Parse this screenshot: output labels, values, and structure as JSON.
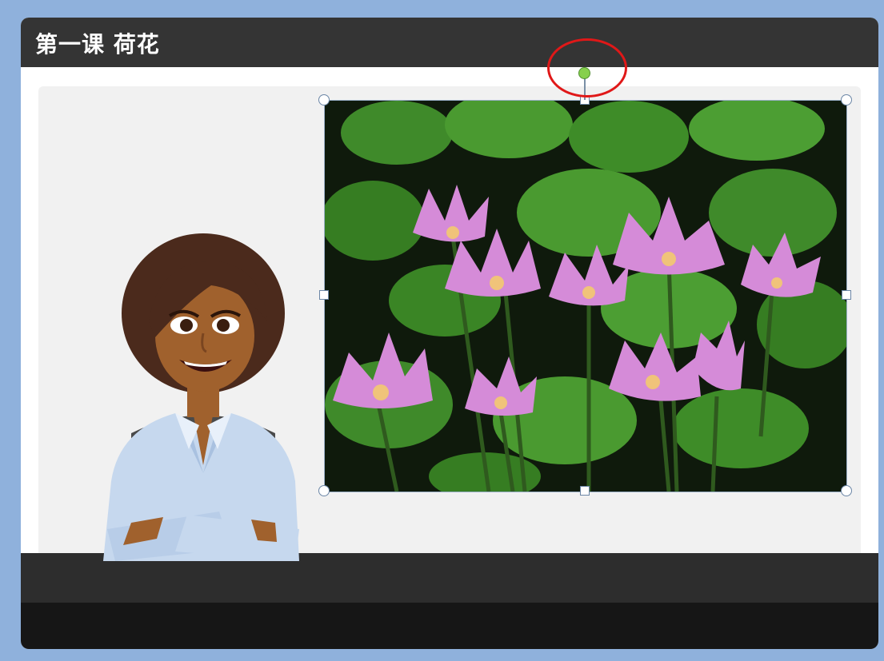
{
  "slide": {
    "title": "第一课 荷花"
  },
  "colors": {
    "background": "#8fb1dc",
    "title_bar": "#343434",
    "panel": "#f1f1f1",
    "desk": "#2d2d2d",
    "highlight": "#e01818",
    "rotate_handle": "#86d04d"
  },
  "elements": {
    "presenter": "cartoon-presenter-illustration",
    "photo": "water-lily-photo",
    "rotation_handle": "rotate-handle-icon",
    "annotation": "red-circle-annotation"
  }
}
